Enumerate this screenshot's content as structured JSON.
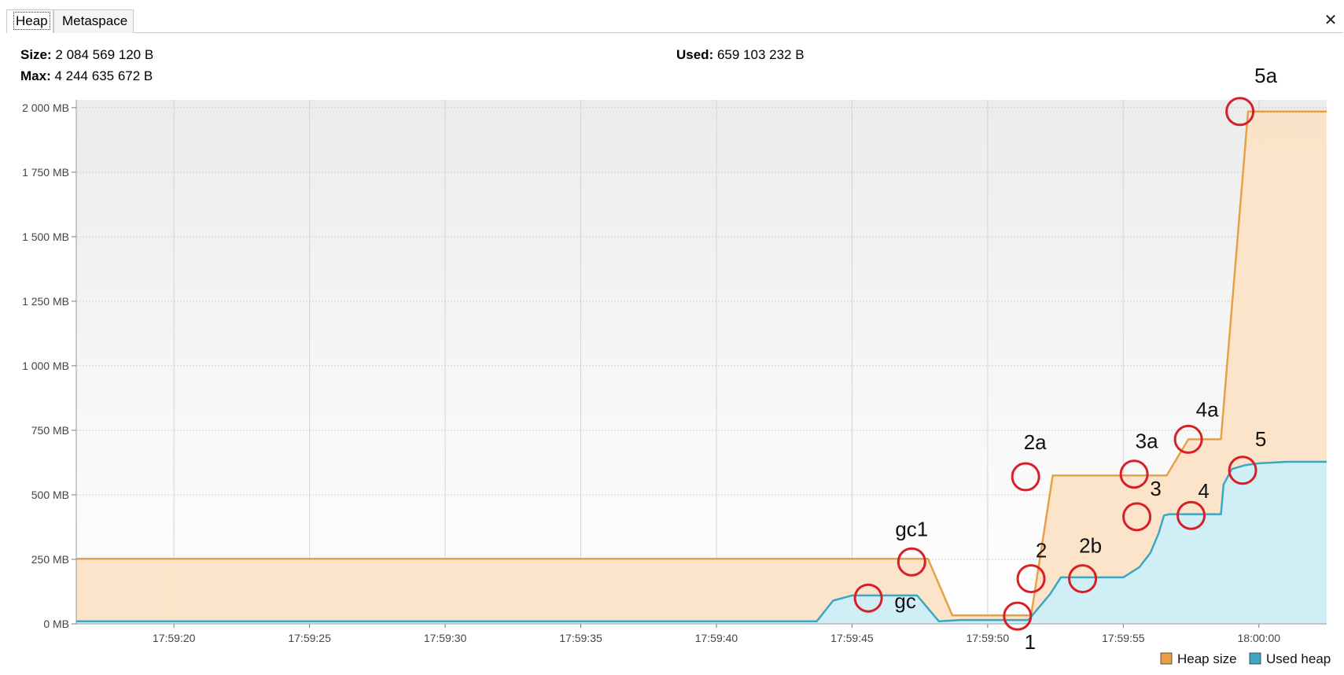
{
  "tabs": [
    {
      "label": "Heap",
      "active": true
    },
    {
      "label": "Metaspace",
      "active": false
    }
  ],
  "close_icon": "close-icon",
  "stats": {
    "size_label": "Size:",
    "size_value": "2 084 569 120 B",
    "max_label": "Max:",
    "max_value": "4 244 635 672 B",
    "used_label": "Used:",
    "used_value": "659 103 232 B"
  },
  "colors": {
    "heap_size": "#e8a046",
    "used_heap": "#3ba7c2",
    "heap_fill": "#fbe3c6",
    "used_fill": "#cdeef8",
    "marker": "#d91f26"
  },
  "chart_data": {
    "type": "area",
    "yticks": [
      "0 MB",
      "250 MB",
      "500 MB",
      "750 MB",
      "1 000 MB",
      "1 250 MB",
      "1 500 MB",
      "1 750 MB",
      "2 000 MB"
    ],
    "ytick_values": [
      0,
      250,
      500,
      750,
      1000,
      1250,
      1500,
      1750,
      2000
    ],
    "ylim": [
      0,
      2030
    ],
    "xticks": [
      "17:59:20",
      "17:59:25",
      "17:59:30",
      "17:59:35",
      "17:59:40",
      "17:59:45",
      "17:59:50",
      "17:59:55",
      "18:00:00"
    ],
    "xtick_values": [
      20,
      25,
      30,
      35,
      40,
      45,
      50,
      55,
      60
    ],
    "xlim": [
      16.4,
      62.5
    ],
    "grid": true,
    "legend_position": "bottom-right",
    "series": [
      {
        "name": "Heap size",
        "color": "#e8a046",
        "x": [
          16.4,
          47.8,
          48.7,
          50.7,
          51.6,
          52.4,
          56.6,
          57.4,
          58.6,
          59.6,
          62.5
        ],
        "y": [
          252,
          252,
          33,
          33,
          33,
          575,
          575,
          715,
          715,
          1985,
          1985
        ]
      },
      {
        "name": "Used heap",
        "color": "#3ba7c2",
        "x": [
          16.4,
          41.2,
          42.0,
          43.7,
          44.3,
          45.0,
          45.4,
          46.3,
          47.4,
          48.2,
          49.0,
          49.6,
          50.0,
          50.6,
          51.0,
          51.3,
          51.5,
          52.3,
          52.7,
          53.5,
          54.3,
          55.0,
          55.6,
          56.0,
          56.3,
          56.5,
          56.7,
          56.9,
          57.2,
          57.6,
          58.0,
          58.3,
          58.6,
          58.7,
          59.0,
          59.5,
          60.0,
          60.5,
          61.0,
          62.5
        ],
        "y": [
          10,
          10,
          10,
          10,
          90,
          110,
          110,
          110,
          110,
          10,
          15,
          15,
          15,
          15,
          15,
          15,
          15,
          115,
          180,
          180,
          180,
          180,
          220,
          275,
          350,
          420,
          425,
          425,
          425,
          425,
          425,
          425,
          425,
          540,
          600,
          615,
          622,
          625,
          628,
          628
        ]
      }
    ],
    "annotations": [
      {
        "label": "gc1",
        "x": 47.2,
        "y": 240
      },
      {
        "label": "gc",
        "x": 45.6,
        "y": 100
      },
      {
        "label": "1",
        "x": 51.1,
        "y": 30
      },
      {
        "label": "2",
        "x": 51.6,
        "y": 175
      },
      {
        "label": "2a",
        "x": 51.4,
        "y": 570
      },
      {
        "label": "2b",
        "x": 53.5,
        "y": 175
      },
      {
        "label": "3",
        "x": 55.5,
        "y": 415
      },
      {
        "label": "3a",
        "x": 55.4,
        "y": 580
      },
      {
        "label": "4",
        "x": 57.5,
        "y": 420
      },
      {
        "label": "4a",
        "x": 57.4,
        "y": 715
      },
      {
        "label": "5",
        "x": 59.4,
        "y": 595
      },
      {
        "label": "5a",
        "x": 59.3,
        "y": 1985
      }
    ],
    "annotation_label_offsets": {
      "gc1": [
        0,
        -33
      ],
      "gc": [
        47,
        13
      ],
      "1": [
        16,
        42
      ],
      "2": [
        13,
        -27
      ],
      "2a": [
        12,
        -35
      ],
      "2b": [
        10,
        -33
      ],
      "3": [
        24,
        -27
      ],
      "3a": [
        16,
        -33
      ],
      "4": [
        16,
        -22
      ],
      "4a": [
        24,
        -29
      ],
      "5": [
        23,
        -31
      ],
      "5a": [
        33,
        -37
      ]
    },
    "legend": [
      "Heap size",
      "Used heap"
    ]
  }
}
